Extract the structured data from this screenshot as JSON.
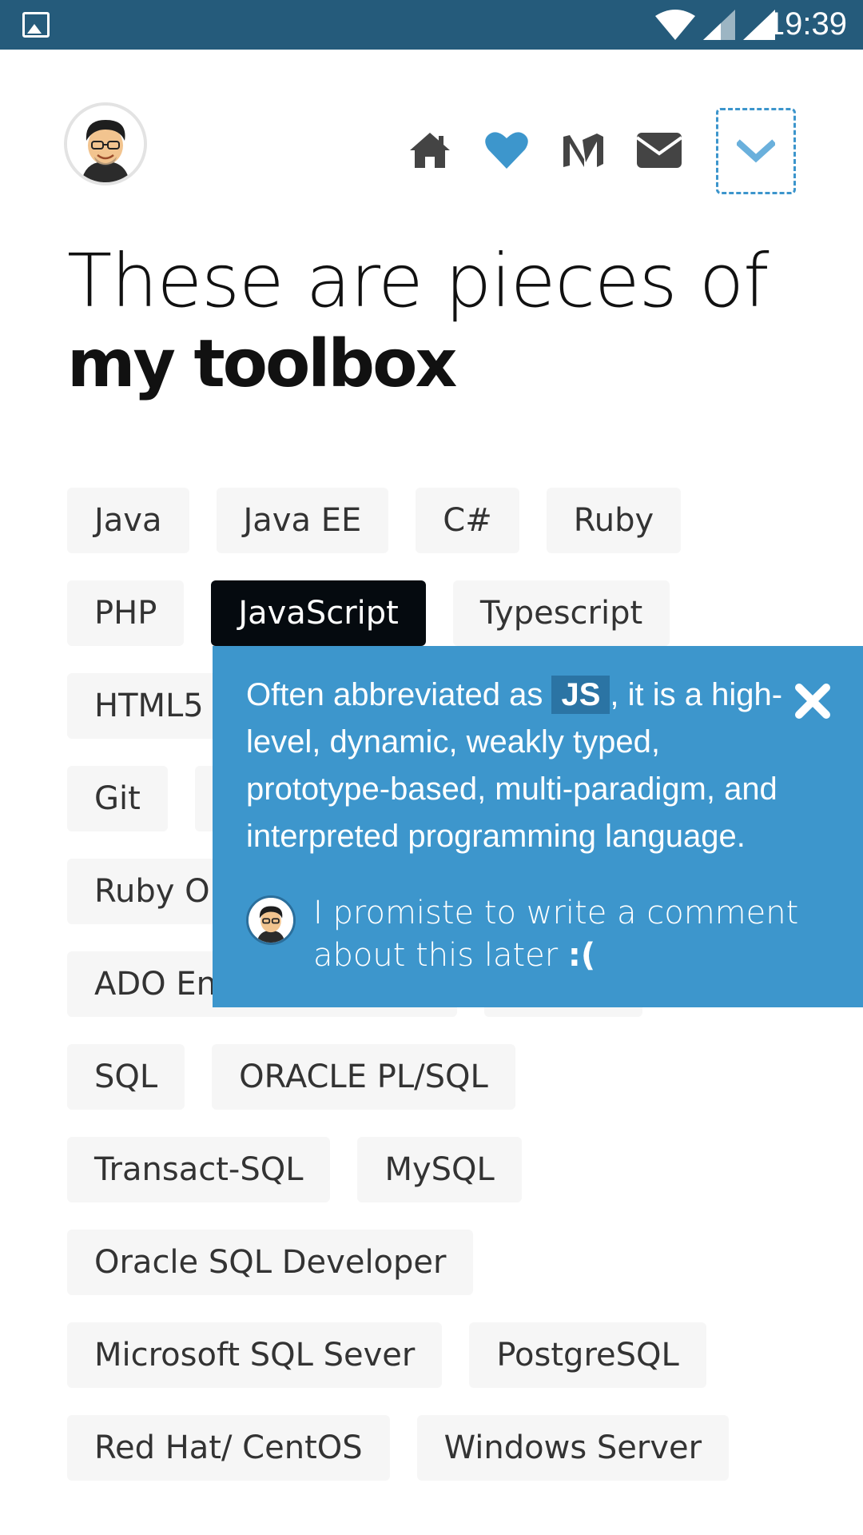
{
  "status_bar": {
    "time": "19:39",
    "icons": [
      "image-icon",
      "wifi-icon",
      "signal-icon",
      "signal-icon"
    ]
  },
  "header": {
    "avatar_icon": "avatar-face",
    "nav": [
      "home-icon",
      "heart-icon",
      "medium-icon",
      "mail-icon"
    ],
    "menu_toggle_icon": "chevron-down-icon",
    "accent": "#3d96cc"
  },
  "headline": {
    "line1": "These are pieces of",
    "line2": "my toolbox"
  },
  "tags": {
    "rows": [
      [
        "Java",
        "Java EE",
        "C#",
        "Ruby"
      ],
      [
        "PHP",
        "JavaScript",
        "Typescript"
      ],
      [
        "HTML5"
      ],
      [
        "Git"
      ],
      [
        "Ruby On"
      ],
      [
        "ADO En"
      ],
      [
        "SQL",
        "ORACLE PL/SQL"
      ],
      [
        "Transact-SQL",
        "MySQL"
      ],
      [
        "Oracle SQL Developer"
      ],
      [
        "Microsoft SQL Sever",
        "PostgreSQL"
      ],
      [
        "Red Hat/ CentOS",
        "Windows Server"
      ]
    ],
    "active": "JavaScript"
  },
  "popover": {
    "text_before": "Often abbreviated as ",
    "abbr": "JS",
    "text_after": ", it is a high-level, dynamic, weakly typed, prototype-based, multi-paradigm, and interpreted programming language.",
    "comment_text": "I promiste to write a comment about this later ",
    "comment_emote": ":(",
    "close_icon": "close-icon",
    "background": "#3d96cc"
  }
}
